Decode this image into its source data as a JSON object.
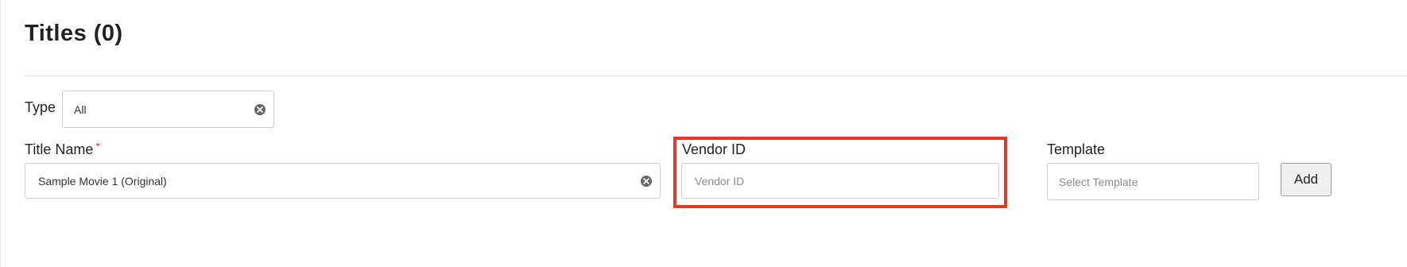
{
  "page": {
    "title": "Titles (0)"
  },
  "filters": {
    "type": {
      "label": "Type",
      "value": "All"
    },
    "title_name": {
      "label": "Title Name",
      "required_mark": "*",
      "value": "Sample Movie 1 (Original)"
    },
    "vendor_id": {
      "label": "Vendor ID",
      "placeholder": "Vendor ID",
      "value": ""
    },
    "template": {
      "label": "Template",
      "placeholder": "Select Template"
    }
  },
  "actions": {
    "add_label": "Add"
  },
  "icons": {
    "clear": "clear-circle-x-icon"
  },
  "colors": {
    "highlight": "#e03c24",
    "required": "#d9412b"
  }
}
